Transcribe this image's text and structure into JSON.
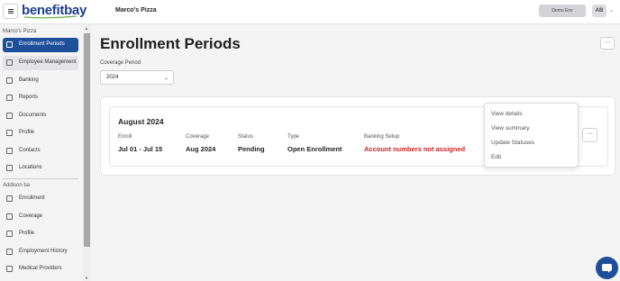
{
  "header": {
    "logo_text": "benefitbay",
    "company_name": "Marco's Pizza",
    "env_label": "Demo Env",
    "user_initials": "AB",
    "brand_color": "#1c3f8f"
  },
  "sidebar": {
    "section1_label": "Marco's Pizza",
    "section1_items": [
      {
        "label": "Enrollment Periods",
        "icon": "calendar-icon"
      },
      {
        "label": "Employee Management",
        "icon": "user-manage-icon"
      },
      {
        "label": "Banking",
        "icon": "bank-icon"
      },
      {
        "label": "Reports",
        "icon": "report-icon"
      },
      {
        "label": "Documents",
        "icon": "document-icon"
      },
      {
        "label": "Profile",
        "icon": "building-icon"
      },
      {
        "label": "Contacts",
        "icon": "contacts-icon"
      },
      {
        "label": "Locations",
        "icon": "location-icon"
      }
    ],
    "section2_label": "Addison ba",
    "section2_items": [
      {
        "label": "Enrollment",
        "icon": "shield-icon"
      },
      {
        "label": "Coverage",
        "icon": "user-icon"
      },
      {
        "label": "Profile",
        "icon": "profile-icon"
      },
      {
        "label": "Employment History",
        "icon": "history-icon"
      },
      {
        "label": "Medical Providers",
        "icon": "medical-icon"
      }
    ],
    "active_color": "#1e4f9b"
  },
  "main": {
    "title": "Enrollment Periods",
    "more_label": "···",
    "coverage_label": "Coverage Period",
    "coverage_value": "2024",
    "period": {
      "title": "August 2024",
      "columns": [
        {
          "label": "Enroll",
          "value": "Jul 01 - Jul 15"
        },
        {
          "label": "Coverage",
          "value": "Aug 2024"
        },
        {
          "label": "Status",
          "value": "Pending"
        },
        {
          "label": "Type",
          "value": "Open Enrollment"
        },
        {
          "label": "Banking Setup",
          "value": "Account numbers not assigned"
        }
      ],
      "more_label": "···",
      "warning_color": "#cc1f1f"
    },
    "menu_items": [
      "View details",
      "View summary",
      "Update Statuses",
      "Edit"
    ]
  }
}
